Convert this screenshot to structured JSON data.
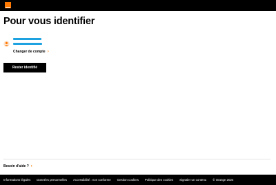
{
  "colors": {
    "brand": "#ff7900",
    "masked_identity": "#1fa3e0",
    "header_bg": "#000000"
  },
  "header": {
    "logo_icon": "orange-logo"
  },
  "main": {
    "title": "Pour vous identifier",
    "account": {
      "avatar_icon": "user-avatar-icon"
    },
    "change_account": "Changer de compte",
    "stay_button": "Rester identifié"
  },
  "help": {
    "label": "Besoin d'aide ?"
  },
  "footer": {
    "links": [
      "Informations légales",
      "Données personnelles",
      "Accessibilité : non conforme",
      "Gestion cookies",
      "Politique des cookies",
      "Signaler un contenu"
    ],
    "copyright": "© Orange 2024"
  }
}
